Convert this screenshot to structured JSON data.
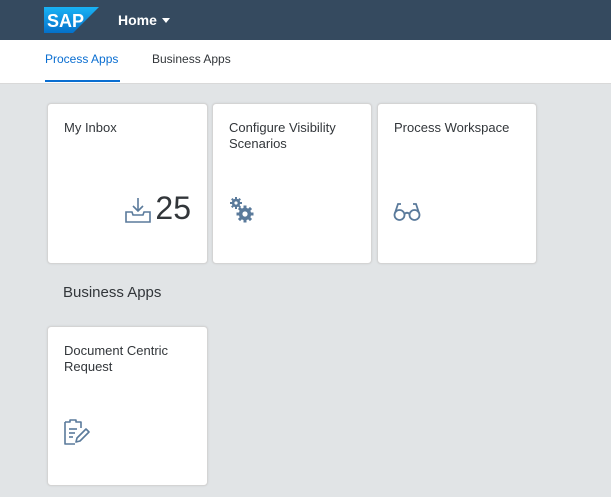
{
  "header": {
    "logo": "SAP",
    "home_label": "Home"
  },
  "tabs": [
    {
      "label": "Process Apps",
      "active": true
    },
    {
      "label": "Business Apps",
      "active": false
    }
  ],
  "process_tiles": [
    {
      "title": "My Inbox",
      "icon": "inbox-download-icon",
      "count": "25"
    },
    {
      "title": "Configure Visibility Scenarios",
      "icon": "gears-icon"
    },
    {
      "title": "Process Workspace",
      "icon": "glasses-icon"
    }
  ],
  "business_group": {
    "title": "Business Apps",
    "tiles": [
      {
        "title": "Document Centric Request",
        "icon": "document-edit-icon"
      }
    ]
  },
  "colors": {
    "shell": "#354a5f",
    "accent": "#0a6ed1",
    "background": "#e1e4e6",
    "icon": "#5a7a9b"
  }
}
